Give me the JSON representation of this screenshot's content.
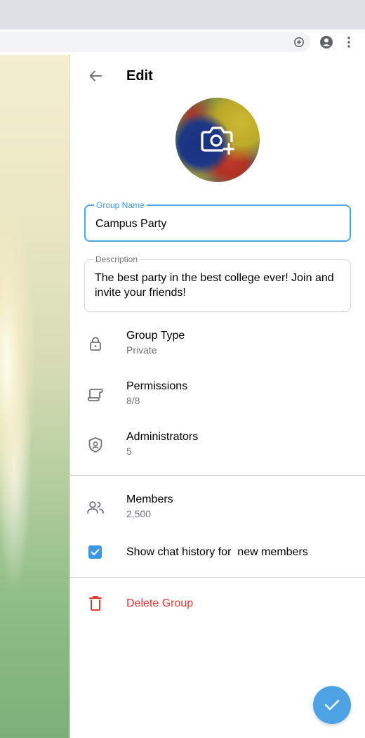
{
  "header": {
    "title": "Edit"
  },
  "group_name": {
    "label": "Group Name",
    "value": "Campus Party"
  },
  "description": {
    "label": "Description",
    "value": "The best party in the best college ever! Join and invite your friends!"
  },
  "settings": [
    {
      "icon": "lock-icon",
      "title": "Group Type",
      "subtitle": "Private"
    },
    {
      "icon": "permissions-icon",
      "title": "Permissions",
      "subtitle": "8/8"
    },
    {
      "icon": "shield-user-icon",
      "title": "Administrators",
      "subtitle": "5"
    }
  ],
  "members": {
    "icon": "users-icon",
    "title": "Members",
    "subtitle": "2,500"
  },
  "chat_history": {
    "label": "Show chat history for  new members",
    "checked": true
  },
  "delete": {
    "label": "Delete Group",
    "color": "#e53935"
  },
  "colors": {
    "accent": "#4ea3e5",
    "danger": "#e53935",
    "secondary_text": "#707579"
  }
}
